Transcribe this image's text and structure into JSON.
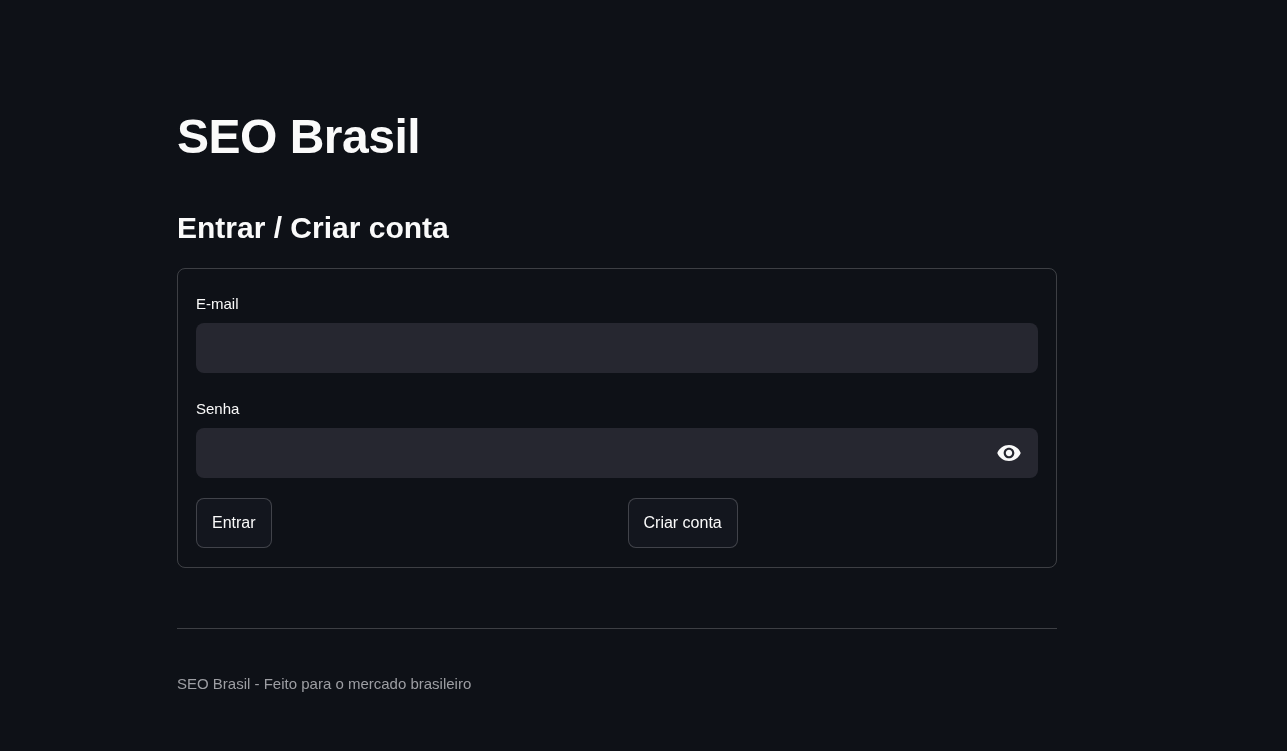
{
  "page_title": "SEO Brasil",
  "section_heading": "Entrar / Criar conta",
  "form": {
    "fields": [
      {
        "kind": "text",
        "label": "E-mail"
      },
      {
        "kind": "password",
        "label": "Senha"
      }
    ],
    "buttons": [
      {
        "label": "Entrar"
      },
      {
        "label": "Criar conta"
      }
    ]
  },
  "footer": {
    "text": "SEO Brasil - Feito para o mercado brasileiro"
  }
}
